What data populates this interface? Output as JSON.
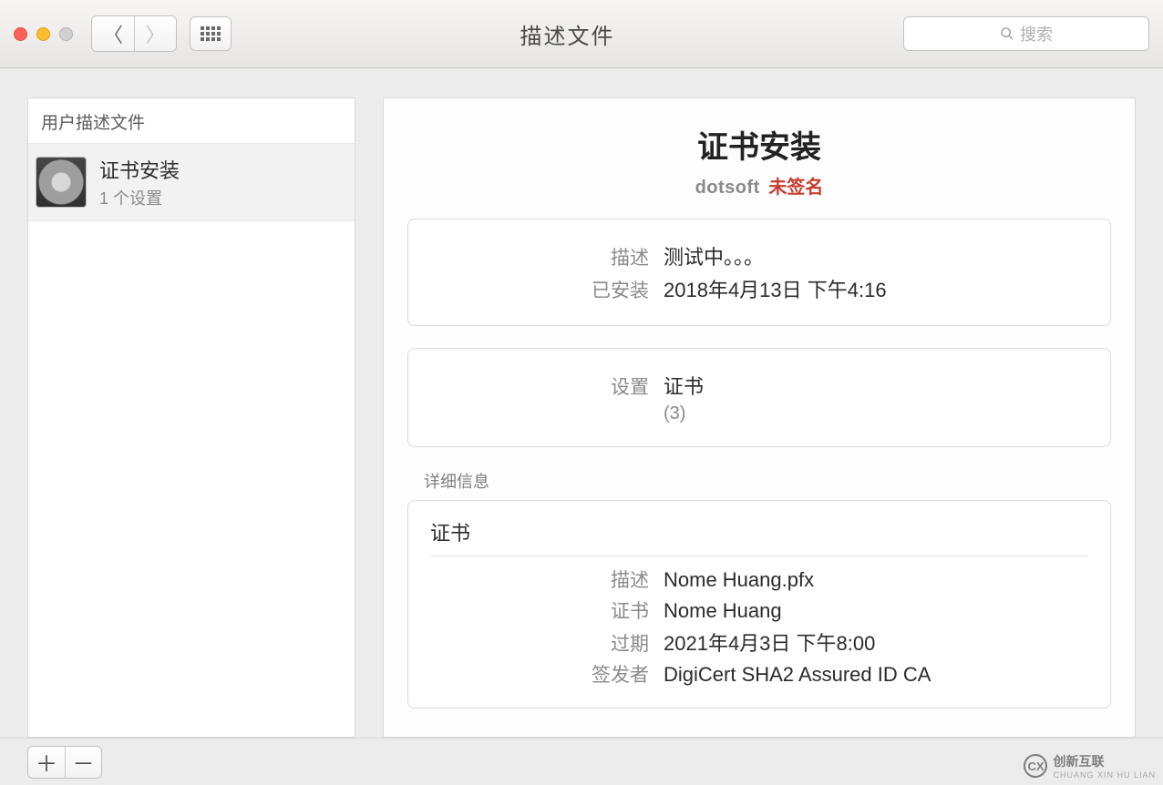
{
  "window": {
    "title": "描述文件",
    "search_placeholder": "搜索"
  },
  "sidebar": {
    "header": "用户描述文件",
    "items": [
      {
        "title": "证书安装",
        "subtitle": "1 个设置"
      }
    ]
  },
  "profile": {
    "title": "证书安装",
    "organization": "dotsoft",
    "sign_status": "未签名",
    "summary": {
      "description_label": "描述",
      "description_value": "测试中。。。",
      "installed_label": "已安装",
      "installed_value": "2018年4月13日 下午4:16"
    },
    "settings": {
      "label": "设置",
      "value": "证书",
      "count": "(3)"
    },
    "details_section_label": "详细信息",
    "details": {
      "heading": "证书",
      "rows": {
        "description_label": "描述",
        "description_value": "Nome Huang.pfx",
        "cert_label": "证书",
        "cert_value": "Nome Huang",
        "expiry_label": "过期",
        "expiry_value": "2021年4月3日 下午8:00",
        "issuer_label": "签发者",
        "issuer_value": "DigiCert SHA2 Assured ID CA"
      }
    }
  },
  "watermark": {
    "brand": "创新互联",
    "sub": "CHUANG XIN HU LIAN",
    "logo_text": "CX"
  }
}
